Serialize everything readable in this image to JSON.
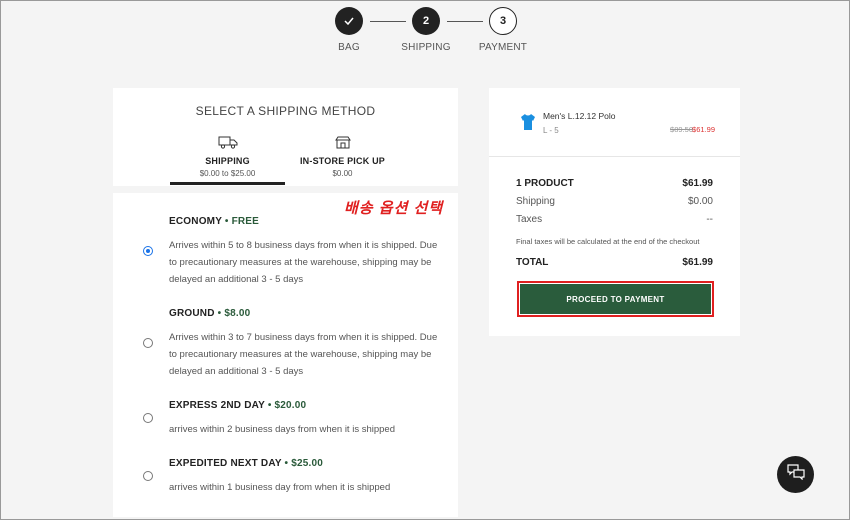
{
  "stepper": {
    "steps": [
      {
        "label": "BAG",
        "number": "",
        "state": "done"
      },
      {
        "label": "SHIPPING",
        "number": "2",
        "state": "active"
      },
      {
        "label": "PAYMENT",
        "number": "3",
        "state": "pending"
      }
    ]
  },
  "shipping": {
    "title": "SELECT A SHIPPING METHOD",
    "tabs": [
      {
        "name": "SHIPPING",
        "price": "$0.00 to $25.00",
        "icon": "truck-icon",
        "selected": true
      },
      {
        "name": "IN-STORE PICK UP",
        "price": "$0.00",
        "icon": "store-icon",
        "selected": false
      }
    ],
    "annotation": "배송 옵션 선택",
    "options": [
      {
        "name": "ECONOMY",
        "sep": "•",
        "price": "FREE",
        "desc": "Arrives within 5 to 8 business days from when it is shipped. Due to precautionary measures at the warehouse, shipping may be delayed an additional 3 - 5 days",
        "checked": true
      },
      {
        "name": "GROUND",
        "sep": "•",
        "price": "$8.00",
        "desc": "Arrives within 3 to 7 business days from when it is shipped. Due to precautionary measures at the warehouse, shipping may be delayed an additional 3 - 5 days",
        "checked": false
      },
      {
        "name": "EXPRESS 2ND DAY",
        "sep": "•",
        "price": "$20.00",
        "desc": "arrives within 2 business days from when it is shipped",
        "checked": false
      },
      {
        "name": "EXPEDITED NEXT DAY",
        "sep": "•",
        "price": "$25.00",
        "desc": "arrives within 1 business day from when it is shipped",
        "checked": false
      }
    ]
  },
  "summary": {
    "product": {
      "name": "Men's L.12.12 Polo",
      "size": "L - 5",
      "old_price": "$89.50",
      "new_price": "$61.99",
      "icon": "polo-shirt-icon",
      "color": "#1a8fe0"
    },
    "count_label": "1 PRODUCT",
    "count_value": "$61.99",
    "shipping_label": "Shipping",
    "shipping_value": "$0.00",
    "taxes_label": "Taxes",
    "taxes_value": "--",
    "note": "Final taxes will be calculated at the end of the checkout",
    "total_label": "TOTAL",
    "total_value": "$61.99",
    "proceed_label": "PROCEED TO PAYMENT"
  },
  "colors": {
    "accent_green": "#2a5c3c",
    "highlight_red": "#e02020",
    "radio_blue": "#1a73e8"
  },
  "chat": {
    "icon": "chat-bubbles-icon"
  }
}
